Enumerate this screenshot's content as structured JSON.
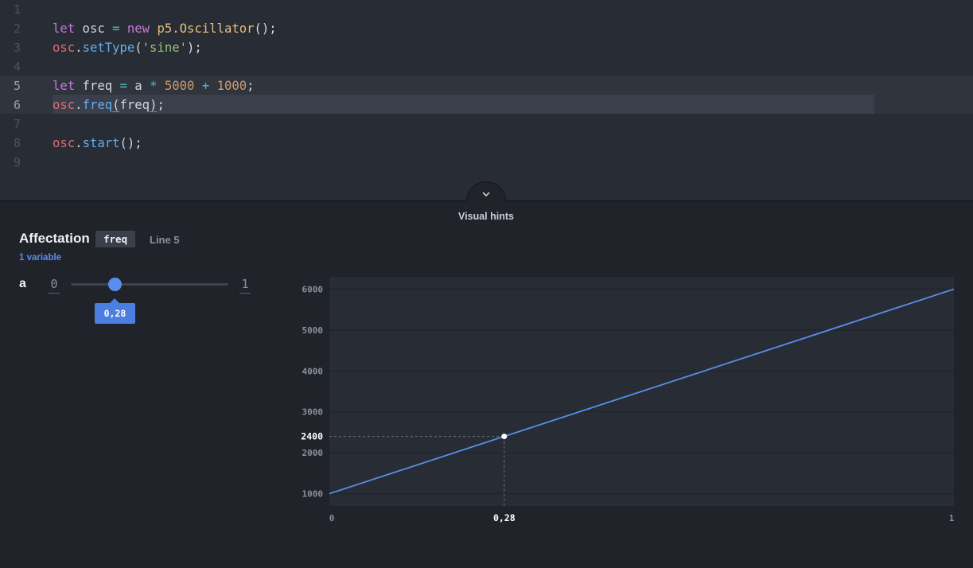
{
  "editor": {
    "lines": [
      {
        "no": "1",
        "tokens": []
      },
      {
        "no": "2",
        "tokens": [
          {
            "t": "let",
            "c": "kw"
          },
          {
            "t": " osc ",
            "c": "var"
          },
          {
            "t": "=",
            "c": "op"
          },
          {
            "t": " new ",
            "c": "kw"
          },
          {
            "t": "p5.Oscillator",
            "c": "cls"
          },
          {
            "t": "();",
            "c": "pun"
          }
        ]
      },
      {
        "no": "3",
        "tokens": [
          {
            "t": "osc",
            "c": "obj"
          },
          {
            "t": ".",
            "c": "pun"
          },
          {
            "t": "setType",
            "c": "fn"
          },
          {
            "t": "(",
            "c": "pun"
          },
          {
            "t": "'sine'",
            "c": "str"
          },
          {
            "t": ");",
            "c": "pun"
          }
        ]
      },
      {
        "no": "4",
        "tokens": []
      },
      {
        "no": "5",
        "tokens": [
          {
            "t": "let",
            "c": "kw"
          },
          {
            "t": " freq ",
            "c": "var"
          },
          {
            "t": "=",
            "c": "op"
          },
          {
            "t": " a ",
            "c": "var"
          },
          {
            "t": "*",
            "c": "op"
          },
          {
            "t": " 5000 ",
            "c": "num"
          },
          {
            "t": "+",
            "c": "op"
          },
          {
            "t": " 1000",
            "c": "num"
          },
          {
            "t": ";",
            "c": "pun"
          }
        ]
      },
      {
        "no": "6",
        "tokens": [
          {
            "t": "osc",
            "c": "obj"
          },
          {
            "t": ".",
            "c": "pun"
          },
          {
            "t": "freq",
            "c": "fn"
          },
          {
            "t": "(",
            "c": "pun ul"
          },
          {
            "t": "freq",
            "c": "var"
          },
          {
            "t": ")",
            "c": "pun ul"
          },
          {
            "t": ";",
            "c": "pun"
          }
        ]
      },
      {
        "no": "7",
        "tokens": []
      },
      {
        "no": "8",
        "tokens": [
          {
            "t": "osc",
            "c": "obj"
          },
          {
            "t": ".",
            "c": "pun"
          },
          {
            "t": "start",
            "c": "fn"
          },
          {
            "t": "();",
            "c": "pun"
          }
        ]
      },
      {
        "no": "9",
        "tokens": []
      }
    ]
  },
  "panel": {
    "title": "Visual hints",
    "toggle_icon": "chevron-down-icon"
  },
  "affectation": {
    "title": "Affectation",
    "variable": "freq",
    "line": "Line 5",
    "variable_count": "1 variable"
  },
  "slider": {
    "name": "a",
    "min": "0",
    "max": "1",
    "value": 0.28,
    "value_label": "0,28"
  },
  "colors": {
    "accent": "#5b8def",
    "line": "#5b8def",
    "plot_bg": "#282c34",
    "grid": "#1f2228"
  },
  "chart_data": {
    "type": "line",
    "x": [
      0,
      1
    ],
    "y": [
      1000,
      6000
    ],
    "xlim": [
      0,
      1
    ],
    "ylim": [
      1000,
      6000
    ],
    "xticks": [
      "0",
      "1"
    ],
    "yticks": [
      1000,
      2000,
      3000,
      4000,
      5000,
      6000
    ],
    "grid": true,
    "marker": {
      "x": 0.28,
      "y": 2400,
      "x_label": "0,28",
      "y_label": "2400"
    }
  }
}
